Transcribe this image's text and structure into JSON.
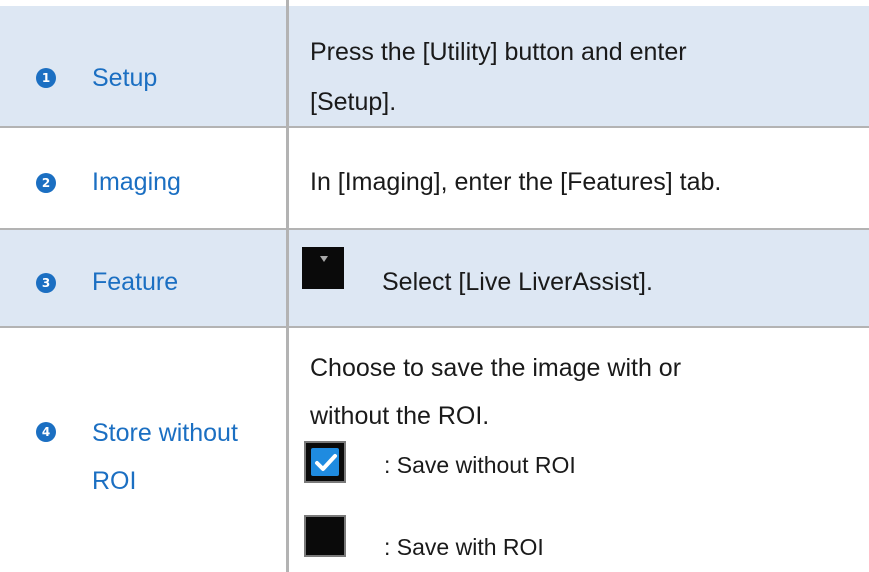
{
  "rows": [
    {
      "number": "1",
      "label_lines": [
        "Setup"
      ],
      "desc_lines": [
        "Press the [Utility] button and enter",
        "[Setup]."
      ]
    },
    {
      "number": "2",
      "label_lines": [
        "Imaging"
      ],
      "desc_lines": [
        "In [Imaging], enter the [Features] tab."
      ]
    },
    {
      "number": "3",
      "label_lines": [
        "Feature"
      ],
      "desc_lines": [
        "Select [Live LiverAssist]."
      ]
    },
    {
      "number": "4",
      "label_lines": [
        "Store without",
        "ROI"
      ],
      "desc_lines": [
        "Choose to save the image with or",
        "without the ROI."
      ],
      "options": [
        {
          "icon": "checkbox-checked-icon",
          "text": ": Save without ROI"
        },
        {
          "icon": "checkbox-empty-icon",
          "text": ": Save with ROI"
        }
      ]
    }
  ],
  "colors": {
    "accent": "#1b6fc2",
    "shade": "#dde7f3",
    "border": "#b3b3b3",
    "checkbox_fill": "#1f8be0"
  }
}
